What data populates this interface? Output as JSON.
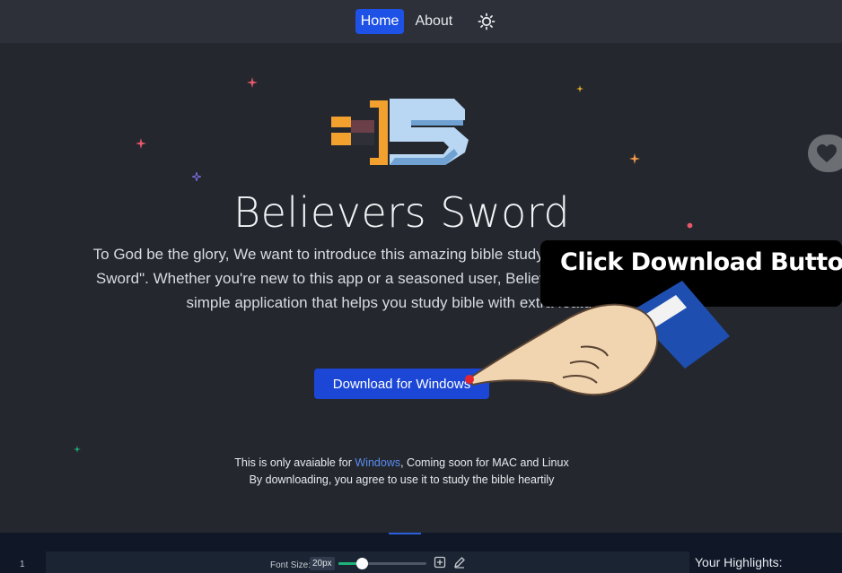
{
  "nav": {
    "items": [
      {
        "label": "Home",
        "active": true
      },
      {
        "label": "About",
        "active": false
      }
    ],
    "theme_icon": "sun-icon"
  },
  "hero": {
    "title": "Believers Sword",
    "description": "To God be the glory, We want to introduce this amazing bible studying app called \"Believers Sword\". Whether you're new to this app or a seasoned user, Believers Sword App is a very simple application that helps you study bible with extra features.",
    "download_label": "Download for Windows",
    "note_prefix": "This is only avaiable for ",
    "note_link": "Windows",
    "note_suffix": ", Coming soon for MAC and Linux",
    "note_line2": "By downloading, you agree to use it to study the bible heartily"
  },
  "overlay": {
    "text": "Click Download Button",
    "icon": "pointing-hand-icon"
  },
  "fab": {
    "icon": "heart-icon"
  },
  "bottom": {
    "line_number": "1",
    "font_size_label": "Font Size:",
    "font_size_value": "20px",
    "font_slider_level": 0.27,
    "highlights_title": "Your Highlights:"
  },
  "colors": {
    "background": "#24272e",
    "navbar": "#2d3038",
    "accent": "#1e52e6",
    "link": "#5b8cf0"
  }
}
